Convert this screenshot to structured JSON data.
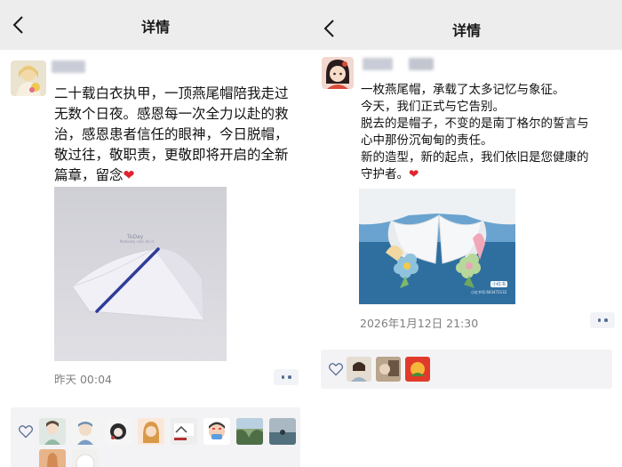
{
  "left": {
    "nav_title": "详情",
    "post_lines": [
      "二十载白衣执甲，一顶燕尾帽陪我走过",
      "无数个日夜。感恩每一次全力以赴的救",
      "治，感恩患者信任的眼神，今日脱帽，",
      "敬过往，敬职责，更敬即将开启的全新",
      "篇章，留念"
    ],
    "heart_emoji": "❤",
    "photo_caption_lines": [
      "ToDay",
      "Nobody can do it"
    ],
    "timestamp": "昨天 00:04"
  },
  "right": {
    "nav_title": "详情",
    "post_lines": [
      "一枚燕尾帽，承载了太多记忆与象征。",
      "今天，我们正式与它告别。",
      "脱去的是帽子，不变的是南丁格尔的誓言与",
      "心中那份沉甸甸的责任。",
      "新的造型，新的起点，我们依旧是您健康的",
      "守护者。"
    ],
    "heart_emoji": "❤",
    "photo_watermark_brand": "小红书",
    "photo_watermark_id": "小红书号:603472132",
    "timestamp": "2026年1月12日 21:30"
  },
  "icons": {
    "back": "chevron-left-icon",
    "like": "heart-outline-icon",
    "more": "more-dots-icon"
  },
  "colors": {
    "nav_bg": "#ededed",
    "link_blue": "#576b95",
    "heart_red": "#e0242f",
    "timestamp_gray": "#7f7f7f"
  }
}
